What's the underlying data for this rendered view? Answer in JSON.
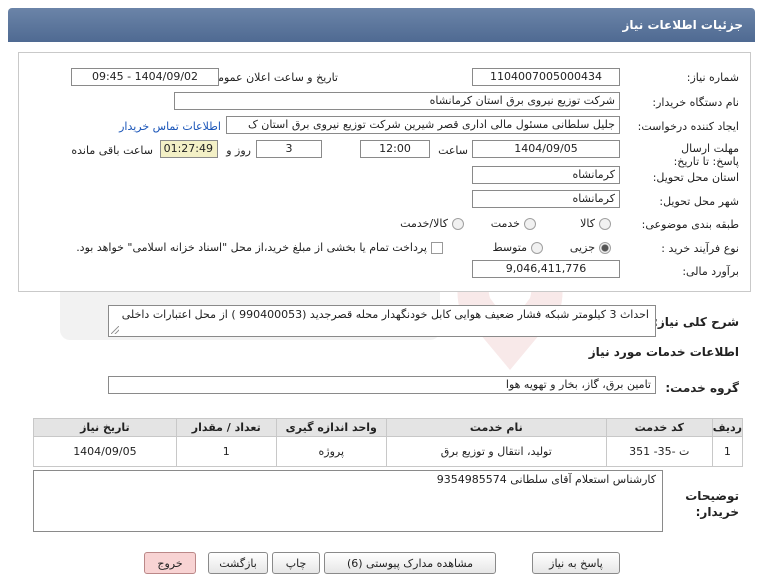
{
  "header": {
    "title": "جزئیات اطلاعات نیاز"
  },
  "form": {
    "need_number_label": "شماره نیاز:",
    "need_number": "1104007005000434",
    "announce_label": "تاریخ و ساعت اعلان عمومی:",
    "announce_value": "1404/09/02 - 09:45",
    "buyer_org_label": "نام دستگاه خریدار:",
    "buyer_org": "شرکت توزیع نیروی برق استان کرمانشاه",
    "creator_label": "ایجاد کننده درخواست:",
    "creator": "جلیل سلطانی مسئول مالی اداری قصر شیرین شرکت توزیع نیروی برق استان ک",
    "contact_link": "اطلاعات تماس خریدار",
    "deadline_label": "مهلت ارسال پاسخ: تا تاریخ:",
    "deadline_date": "1404/09/05",
    "time_label": "ساعت",
    "deadline_time": "12:00",
    "days_value": "3",
    "days_label": "روز و",
    "remaining_time": "01:27:49",
    "remaining_label": "ساعت باقی مانده",
    "province_label": "استان محل تحویل:",
    "province": "کرمانشاه",
    "city_label": "شهر محل تحویل:",
    "city": "کرمانشاه",
    "category_label": "طبقه بندی موضوعی:",
    "category_options": [
      "کالا",
      "خدمت",
      "کالا/خدمت"
    ],
    "category_selected": "",
    "process_label": "نوع فرآیند خرید :",
    "process_options": [
      "جزیی",
      "متوسط"
    ],
    "process_selected": "جزیی",
    "payment_note": "پرداخت تمام یا بخشی از مبلغ خرید،از محل \"اسناد خزانه اسلامی\" خواهد بود.",
    "estimate_label": "برآورد مالی:",
    "estimate": "9,046,411,776"
  },
  "description": {
    "label": "شرح کلی نیاز:",
    "text": "احداث 3 کیلومتر شبکه فشار ضعیف هوایی کابل خودنگهدار محله قصرجدید (990400053 )  از محل اعتبارات داخلی"
  },
  "services": {
    "section_title": "اطلاعات خدمات مورد نیاز",
    "group_label": "گروه خدمت:",
    "group_value": "تامین برق، گاز، بخار و تهویه هوا",
    "columns": [
      "ردیف",
      "کد خدمت",
      "نام خدمت",
      "واحد اندازه گیری",
      "تعداد / مقدار",
      "تاریخ نیاز"
    ],
    "rows": [
      [
        "1",
        "ت -35- 351",
        "تولید، انتقال و توزیع برق",
        "پروژه",
        "1",
        "1404/09/05"
      ]
    ]
  },
  "buyer_notes": {
    "label": "توضیحات خریدار:",
    "text": "کارشناس استعلام آقای سلطانی 9354985574"
  },
  "buttons": {
    "reply": "پاسخ به نیاز",
    "attachments": "مشاهده مدارک پیوستی (6)",
    "print": "چاپ",
    "back": "بازگشت",
    "exit": "خروج"
  },
  "colors": {
    "header": "#5a7399",
    "link": "#1a55b8",
    "highlight": "#f3f0c6",
    "exit": "#f8d3d3"
  }
}
